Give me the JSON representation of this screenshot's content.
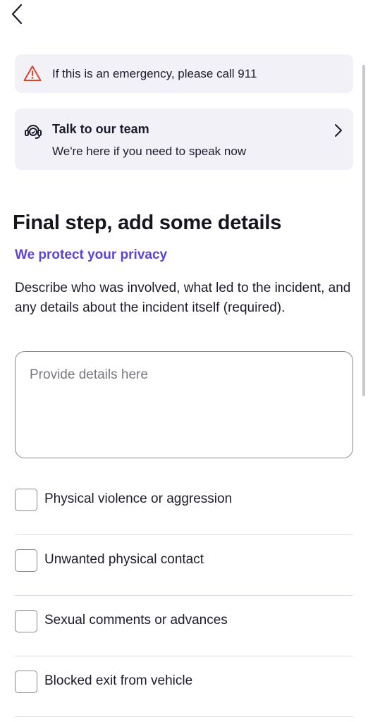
{
  "nav": {
    "back_icon": "chevron-left-icon"
  },
  "emergency": {
    "icon": "warning-triangle-icon",
    "icon_color": "#e0432b",
    "text": "If this is an emergency, please call 911"
  },
  "team": {
    "icon": "support-agent-icon",
    "title": "Talk to our team",
    "subtitle": "We're here if you need to speak now",
    "chevron_icon": "chevron-right-icon"
  },
  "form": {
    "heading": "Final step, add some details",
    "privacy_link": "We protect your privacy",
    "privacy_color": "#5a45d6",
    "description": "Describe who was involved, what led to the incident, and any details about the incident itself (required).",
    "details_placeholder": "Provide details here",
    "details_value": ""
  },
  "options": [
    {
      "label": "Physical violence or aggression",
      "checked": false
    },
    {
      "label": "Unwanted physical contact",
      "checked": false
    },
    {
      "label": "Sexual comments or advances",
      "checked": false
    },
    {
      "label": "Blocked exit from vehicle",
      "checked": false
    }
  ]
}
